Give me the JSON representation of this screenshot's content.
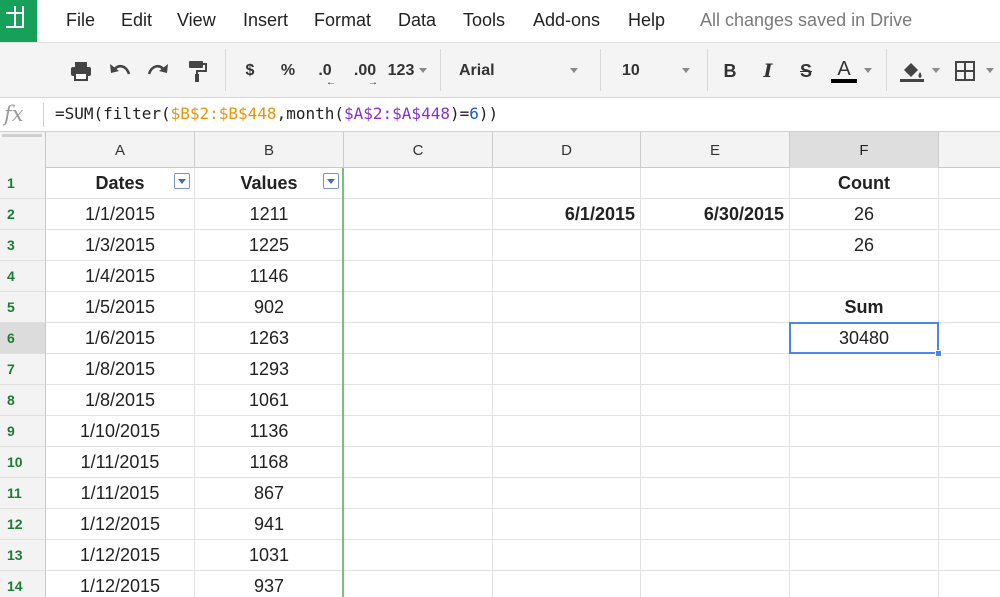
{
  "menu": {
    "items": [
      "File",
      "Edit",
      "View",
      "Insert",
      "Format",
      "Data",
      "Tools",
      "Add-ons",
      "Help"
    ],
    "save_status": "All changes saved in Drive"
  },
  "toolbar": {
    "currency_label": "$",
    "percent_label": "%",
    "decrease_decimal_label": ".0",
    "increase_decimal_label": ".00",
    "number_format_label": "123",
    "font_family": "Arial",
    "font_size": "10",
    "bold_label": "B",
    "italic_label": "I",
    "strikethrough_label": "S",
    "text_color_label": "A",
    "icons": [
      "print-icon",
      "undo-icon",
      "redo-icon",
      "paint-format-icon",
      "fill-color-icon",
      "borders-icon"
    ]
  },
  "formula_bar": {
    "fx_label": "fx",
    "segments": [
      {
        "text": "=SUM(filter(",
        "color": "default"
      },
      {
        "text": "$B$2:$B$448",
        "color": "orange"
      },
      {
        "text": ",month(",
        "color": "default"
      },
      {
        "text": "$A$2:$A$448",
        "color": "purple"
      },
      {
        "text": ")=",
        "color": "default"
      },
      {
        "text": "6",
        "color": "blue"
      },
      {
        "text": "))",
        "color": "default"
      }
    ]
  },
  "sheet": {
    "columns": [
      "A",
      "B",
      "C",
      "D",
      "E",
      "F"
    ],
    "selected_column": "F",
    "selected_row": "6",
    "active_cell": "F6",
    "rows": [
      {
        "num": "1",
        "cells": [
          "Dates",
          "Values",
          "",
          "",
          "",
          "Count"
        ]
      },
      {
        "num": "2",
        "cells": [
          "1/1/2015",
          "1211",
          "",
          "6/1/2015",
          "6/30/2015",
          "26"
        ]
      },
      {
        "num": "3",
        "cells": [
          "1/3/2015",
          "1225",
          "",
          "",
          "",
          "26"
        ]
      },
      {
        "num": "4",
        "cells": [
          "1/4/2015",
          "1146",
          "",
          "",
          "",
          ""
        ]
      },
      {
        "num": "5",
        "cells": [
          "1/5/2015",
          "902",
          "",
          "",
          "",
          "Sum"
        ]
      },
      {
        "num": "6",
        "cells": [
          "1/6/2015",
          "1263",
          "",
          "",
          "",
          "30480"
        ]
      },
      {
        "num": "7",
        "cells": [
          "1/8/2015",
          "1293",
          "",
          "",
          "",
          ""
        ]
      },
      {
        "num": "8",
        "cells": [
          "1/8/2015",
          "1061",
          "",
          "",
          "",
          ""
        ]
      },
      {
        "num": "9",
        "cells": [
          "1/10/2015",
          "1136",
          "",
          "",
          "",
          ""
        ]
      },
      {
        "num": "10",
        "cells": [
          "1/11/2015",
          "1168",
          "",
          "",
          "",
          ""
        ]
      },
      {
        "num": "11",
        "cells": [
          "1/11/2015",
          "867",
          "",
          "",
          "",
          ""
        ]
      },
      {
        "num": "12",
        "cells": [
          "1/12/2015",
          "941",
          "",
          "",
          "",
          ""
        ]
      },
      {
        "num": "13",
        "cells": [
          "1/12/2015",
          "1031",
          "",
          "",
          "",
          ""
        ]
      },
      {
        "num": "14",
        "cells": [
          "1/12/2015",
          "937",
          "",
          "",
          "",
          ""
        ]
      }
    ]
  },
  "colors": {
    "brand_green": "#16a05a",
    "selection_blue": "#4a87e8",
    "row_number_green": "#1e7b34",
    "frozen_line": "#7ac07a"
  }
}
